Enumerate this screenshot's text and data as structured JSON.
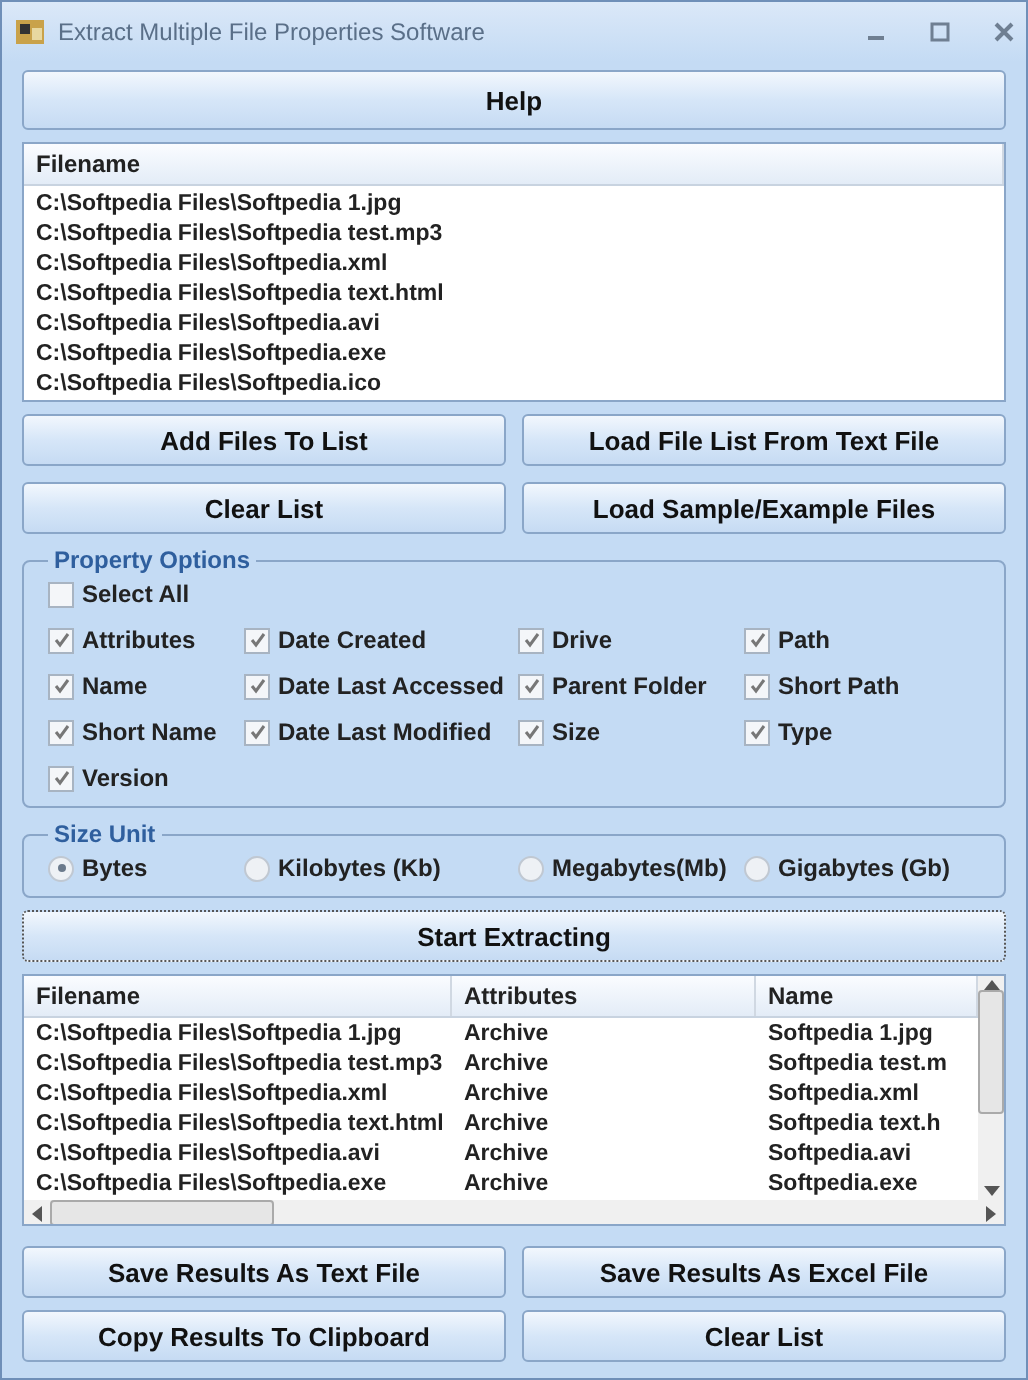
{
  "window": {
    "title": "Extract Multiple File Properties Software"
  },
  "help_button": "Help",
  "file_list": {
    "columns": [
      "Filename"
    ],
    "rows": [
      "C:\\Softpedia Files\\Softpedia 1.jpg",
      "C:\\Softpedia Files\\Softpedia test.mp3",
      "C:\\Softpedia Files\\Softpedia.xml",
      "C:\\Softpedia Files\\Softpedia text.html",
      "C:\\Softpedia Files\\Softpedia.avi",
      "C:\\Softpedia Files\\Softpedia.exe",
      "C:\\Softpedia Files\\Softpedia.ico"
    ]
  },
  "file_buttons": [
    "Add Files To List",
    "Load File List From Text File",
    "Clear List",
    "Load Sample/Example Files"
  ],
  "property_options": {
    "title": "Property Options",
    "select_all": {
      "label": "Select All",
      "checked": false
    },
    "options": [
      {
        "label": "Attributes",
        "checked": true
      },
      {
        "label": "Date Created",
        "checked": true
      },
      {
        "label": "Drive",
        "checked": true
      },
      {
        "label": "Path",
        "checked": true
      },
      {
        "label": "Name",
        "checked": true
      },
      {
        "label": "Date Last Accessed",
        "checked": true
      },
      {
        "label": "Parent Folder",
        "checked": true
      },
      {
        "label": "Short Path",
        "checked": true
      },
      {
        "label": "Short Name",
        "checked": true
      },
      {
        "label": "Date Last Modified",
        "checked": true
      },
      {
        "label": "Size",
        "checked": true
      },
      {
        "label": "Type",
        "checked": true
      },
      {
        "label": "Version",
        "checked": true
      }
    ]
  },
  "size_unit": {
    "title": "Size Unit",
    "options": [
      {
        "label": "Bytes",
        "selected": true
      },
      {
        "label": "Kilobytes (Kb)",
        "selected": false
      },
      {
        "label": "Megabytes(Mb)",
        "selected": false
      },
      {
        "label": "Gigabytes (Gb)",
        "selected": false
      }
    ]
  },
  "start_button": "Start Extracting",
  "results": {
    "columns": [
      "Filename",
      "Attributes",
      "Name"
    ],
    "rows": [
      [
        "C:\\Softpedia Files\\Softpedia 1.jpg",
        "Archive",
        "Softpedia 1.jpg"
      ],
      [
        "C:\\Softpedia Files\\Softpedia test.mp3",
        "Archive",
        "Softpedia test.m"
      ],
      [
        "C:\\Softpedia Files\\Softpedia.xml",
        "Archive",
        "Softpedia.xml"
      ],
      [
        "C:\\Softpedia Files\\Softpedia text.html",
        "Archive",
        "Softpedia text.h"
      ],
      [
        "C:\\Softpedia Files\\Softpedia.avi",
        "Archive",
        "Softpedia.avi"
      ],
      [
        "C:\\Softpedia Files\\Softpedia.exe",
        "Archive",
        "Softpedia.exe"
      ]
    ]
  },
  "result_buttons": [
    "Save Results As Text File",
    "Save Results As Excel File",
    "Copy Results To Clipboard",
    "Clear List"
  ]
}
